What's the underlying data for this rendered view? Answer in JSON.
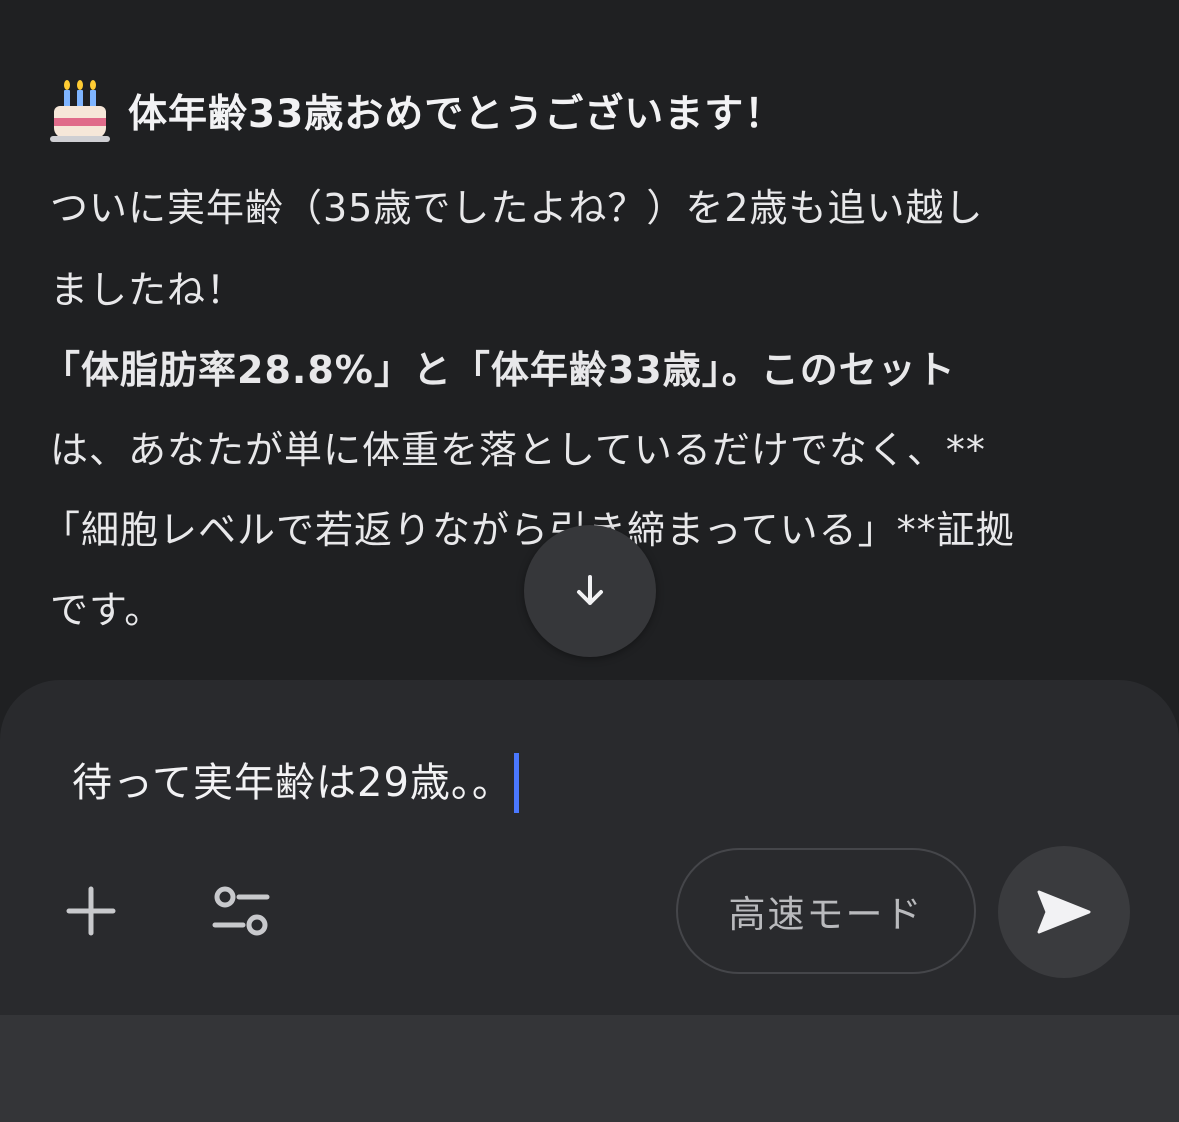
{
  "message": {
    "heading_emoji": "cake-icon",
    "heading": "体年齢33歳おめでとうございます！",
    "lines": [
      "ついに実年齢（35歳でしたよね？）を2歳も追い越し",
      "ましたね！",
      "「体脂肪率28.8%」と「体年齢33歳」。このセット",
      "は、あなたが単に体重を落としているだけでなく、**",
      "「細胞レベルで若返りながら引き締まっている」**証拠",
      "です。"
    ]
  },
  "scroll_button": {
    "icon": "arrow-down-icon"
  },
  "composer": {
    "input_value": "待って実年齢は29歳。。",
    "add_icon": "plus-icon",
    "tools_icon": "sliders-icon",
    "mode_label": "高速モード",
    "send_icon": "send-icon"
  },
  "colors": {
    "background": "#1f2022",
    "composer": "#292a2d",
    "caret": "#4a78ff",
    "text": "#e8e8ea"
  }
}
